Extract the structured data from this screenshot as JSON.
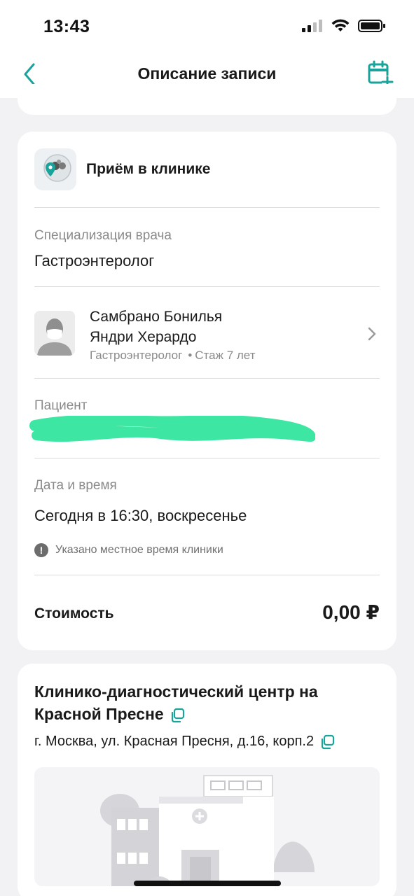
{
  "status_bar": {
    "time": "13:43"
  },
  "header": {
    "title": "Описание записи"
  },
  "visit": {
    "type": "Приём в клинике"
  },
  "specialization": {
    "label": "Специализация врача",
    "value": "Гастроэнтеролог"
  },
  "doctor": {
    "name_line1": "Самбрано Бонилья",
    "name_line2": "Яндри Херардо",
    "specialty": "Гастроэнтеролог",
    "experience": "Стаж 7 лет"
  },
  "patient": {
    "label": "Пациент"
  },
  "datetime": {
    "label": "Дата и время",
    "value": "Сегодня в 16:30, воскресенье",
    "note": "Указано местное время клиники"
  },
  "cost": {
    "label": "Стоимость",
    "value": "0,00 ₽"
  },
  "clinic": {
    "name": "Клинико-диагностический центр на Красной Пресне",
    "address": "г. Москва, ул. Красная Пресня, д.16, корп.2"
  },
  "colors": {
    "accent": "#1aa39a",
    "redaction": "#3ee6a4"
  }
}
